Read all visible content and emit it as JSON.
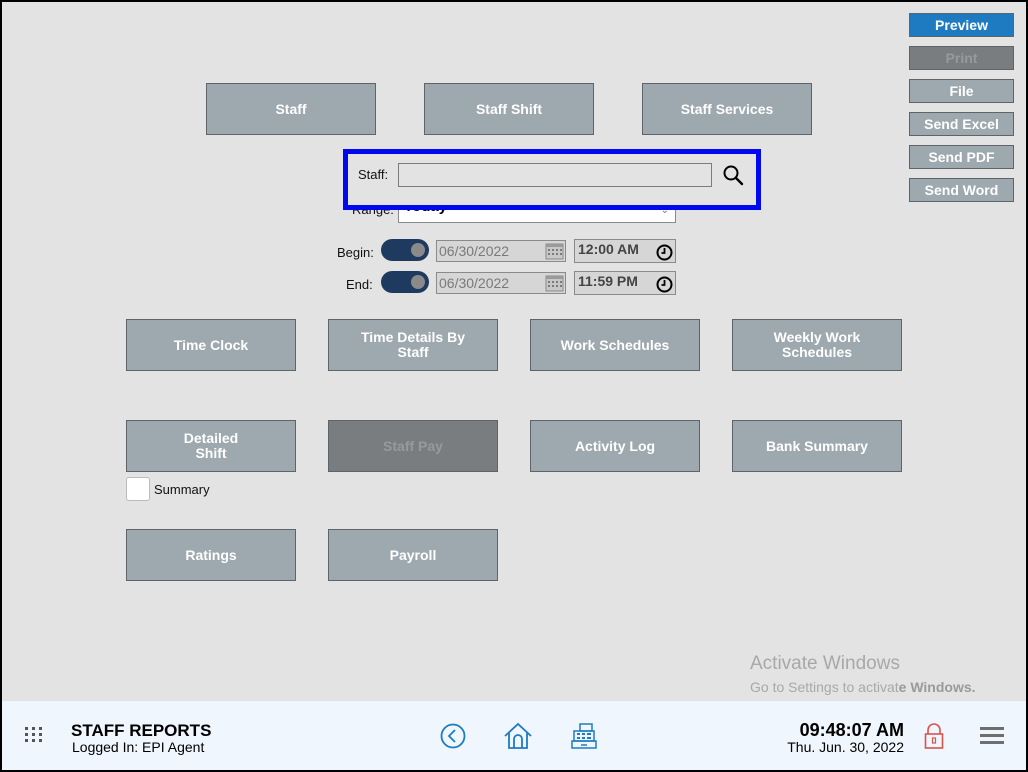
{
  "side_buttons": [
    {
      "label": "Preview",
      "state": "primary"
    },
    {
      "label": "Print",
      "state": "disabled"
    },
    {
      "label": "File",
      "state": "normal"
    },
    {
      "label": "Send Excel",
      "state": "normal"
    },
    {
      "label": "Send PDF",
      "state": "normal"
    },
    {
      "label": "Send Word",
      "state": "normal"
    }
  ],
  "top_tabs": [
    "Staff",
    "Staff Shift",
    "Staff Services"
  ],
  "filters": {
    "staff_label": "Staff:",
    "staff_value": "",
    "range_label": "Range:",
    "range_value": "Today",
    "begin_label": "Begin:",
    "begin_date": "06/30/2022",
    "begin_time": "12:00 AM",
    "end_label": "End:",
    "end_date": "06/30/2022",
    "end_time": "11:59 PM"
  },
  "reports": {
    "time_clock": "Time Clock",
    "time_details_l1": "Time Details By",
    "time_details_l2": "Staff",
    "work_schedules": "Work Schedules",
    "weekly_l1": "Weekly Work",
    "weekly_l2": "Schedules",
    "detailed_l1": "Detailed",
    "detailed_l2": "Shift",
    "staff_pay": "Staff Pay",
    "activity_log": "Activity Log",
    "bank_summary": "Bank Summary",
    "ratings": "Ratings",
    "payroll": "Payroll",
    "summary_label": "Summary"
  },
  "watermark": {
    "line1": "Activate Windows",
    "line2_a": "Go to Settings to activat",
    "line2_b": "e Windows."
  },
  "footer": {
    "title": "STAFF REPORTS",
    "logged_in": "Logged In:  EPI Agent",
    "time": "09:48:07 AM",
    "date": "Thu. Jun. 30, 2022"
  },
  "colors": {
    "accent": "#1f7bc1",
    "highlight": "#0008f0",
    "lock": "#d9534f",
    "nav_icons": "#1f7bc1"
  }
}
